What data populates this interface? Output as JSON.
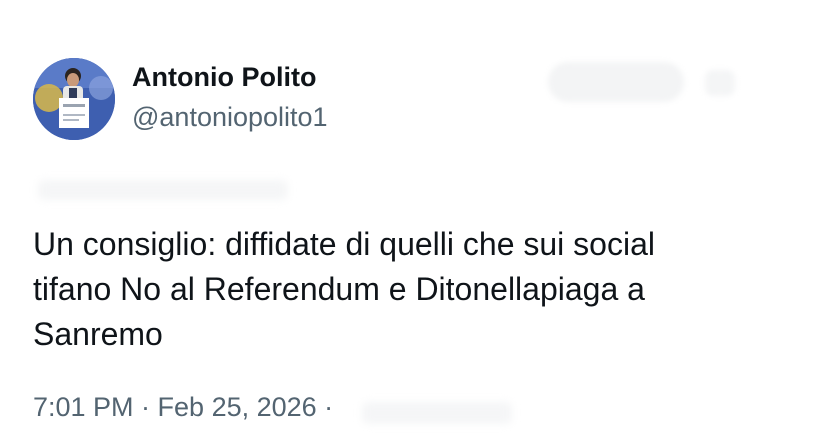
{
  "author": {
    "display_name": "Antonio Polito",
    "handle": "@antoniopolito1"
  },
  "tweet": {
    "lines": [
      "Un consiglio: diffidate di quelli che sui social",
      "tifano No al Referendum e Ditonellapiaga a",
      "Sanremo"
    ],
    "timestamp": "7:01 PM · Feb 25, 2026 ·"
  },
  "colors": {
    "text_primary": "#0f1419",
    "text_secondary": "#536471",
    "avatar_background": "#3e5fb0"
  },
  "icons": {
    "avatar": "profile-photo",
    "more": "more-dots-icon"
  }
}
